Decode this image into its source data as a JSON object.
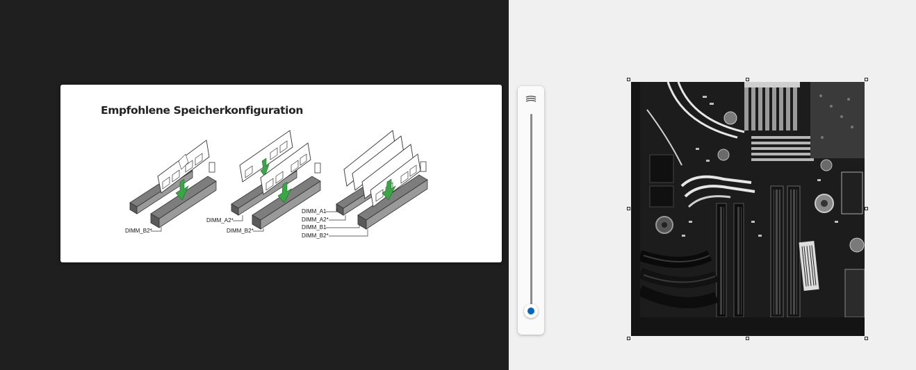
{
  "document": {
    "title": "Empfohlene Speicherkonfiguration",
    "labels": {
      "config1": [
        "DIMM_B2*"
      ],
      "config2": [
        "DIMM_A2*",
        "DIMM_B2*"
      ],
      "config3": [
        "DIMM_A1",
        "DIMM_A2*",
        "DIMM_B1",
        "DIMM_B2*"
      ]
    }
  },
  "zoom_slider": {
    "icon": "mountain-landscape-icon",
    "level": 0.02,
    "accent": "#0067c0"
  },
  "photo": {
    "subject": "motherboard-photo",
    "selected": true
  },
  "colors": {
    "left_background": "#1f1f1f",
    "right_background": "#f0f0f0",
    "arrow_green": "#3aa648"
  }
}
